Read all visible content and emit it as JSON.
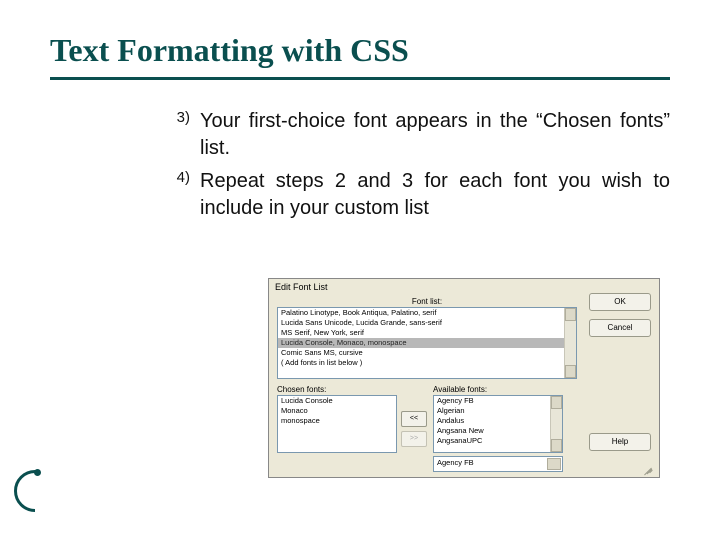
{
  "title": "Text Formatting with CSS",
  "steps": [
    {
      "n": "3)",
      "text": "Your first-choice font appears in the “Chosen fonts” list."
    },
    {
      "n": "4)",
      "text": "Repeat steps 2 and 3 for each font you wish to include in your custom list"
    }
  ],
  "dialog": {
    "title": "Edit Font List",
    "fontlist_label": "Font list:",
    "fontlist_items": [
      "Palatino Linotype, Book Antiqua, Palatino, serif",
      "Lucida Sans Unicode, Lucida Grande, sans-serif",
      "MS Serif, New York, serif",
      "Lucida Console, Monaco, monospace",
      "Comic Sans MS, cursive",
      "( Add fonts in list below )"
    ],
    "fontlist_selected_index": 3,
    "chosen_label": "Chosen fonts:",
    "chosen_items": [
      "Lucida Console",
      "Monaco",
      "monospace"
    ],
    "avail_label": "Available fonts:",
    "avail_items": [
      "Agency FB",
      "Algerian",
      "Andalus",
      "Angsana New",
      "AngsanaUPC"
    ],
    "avail_selected": "Agency FB",
    "btn_move_left": "<<",
    "btn_move_right": ">>",
    "btn_ok": "OK",
    "btn_cancel": "Cancel",
    "btn_help": "Help"
  }
}
